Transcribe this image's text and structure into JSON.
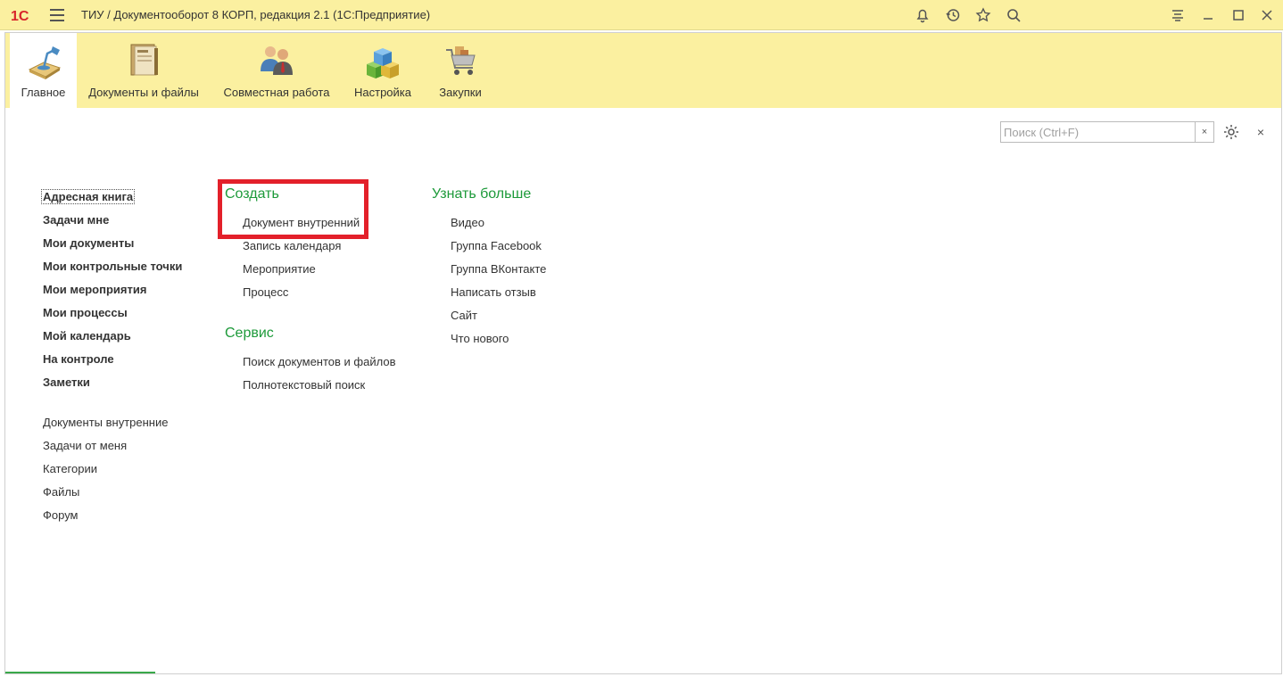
{
  "window": {
    "title": "ТИУ / Документооборот 8 КОРП, редакция 2.1  (1С:Предприятие)",
    "logo_text": "1С"
  },
  "titlebar_icons": [
    "bell-icon",
    "history-icon",
    "star-icon",
    "search-icon",
    "menu-lines-icon",
    "minimize-icon",
    "maximize-icon",
    "close-icon"
  ],
  "sections": [
    {
      "label": "Главное",
      "icon": "desk-lamp-icon",
      "active": true
    },
    {
      "label": "Документы и файлы",
      "icon": "folder-documents-icon",
      "active": false
    },
    {
      "label": "Совместная работа",
      "icon": "people-icon",
      "active": false
    },
    {
      "label": "Настройка",
      "icon": "cubes-icon",
      "active": false
    },
    {
      "label": "Закупки",
      "icon": "shopping-cart-icon",
      "active": false
    }
  ],
  "search": {
    "placeholder": "Поиск (Ctrl+F)",
    "value": "",
    "clear_label": "×"
  },
  "close_label": "×",
  "nav_main": [
    "Адресная книга",
    "Задачи мне",
    "Мои документы",
    "Мои контрольные точки",
    "Мои мероприятия",
    "Мои процессы",
    "Мой календарь",
    "На контроле",
    "Заметки"
  ],
  "nav_secondary": [
    "Документы внутренние",
    "Задачи от меня",
    "Категории",
    "Файлы",
    "Форум"
  ],
  "create_group": {
    "title": "Создать",
    "items": [
      "Документ внутренний",
      "Запись календаря",
      "Мероприятие",
      "Процесс"
    ]
  },
  "service_group": {
    "title": "Сервис",
    "items": [
      "Поиск документов и файлов",
      "Полнотекстовый поиск"
    ]
  },
  "learn_group": {
    "title": "Узнать больше",
    "items": [
      "Видео",
      "Группа Facebook",
      "Группа ВКонтакте",
      "Написать отзыв",
      "Сайт",
      "Что нового"
    ]
  },
  "colors": {
    "header_bg": "#fbf0a0",
    "group_title": "#1d9a3a",
    "highlight": "#e3202a"
  }
}
